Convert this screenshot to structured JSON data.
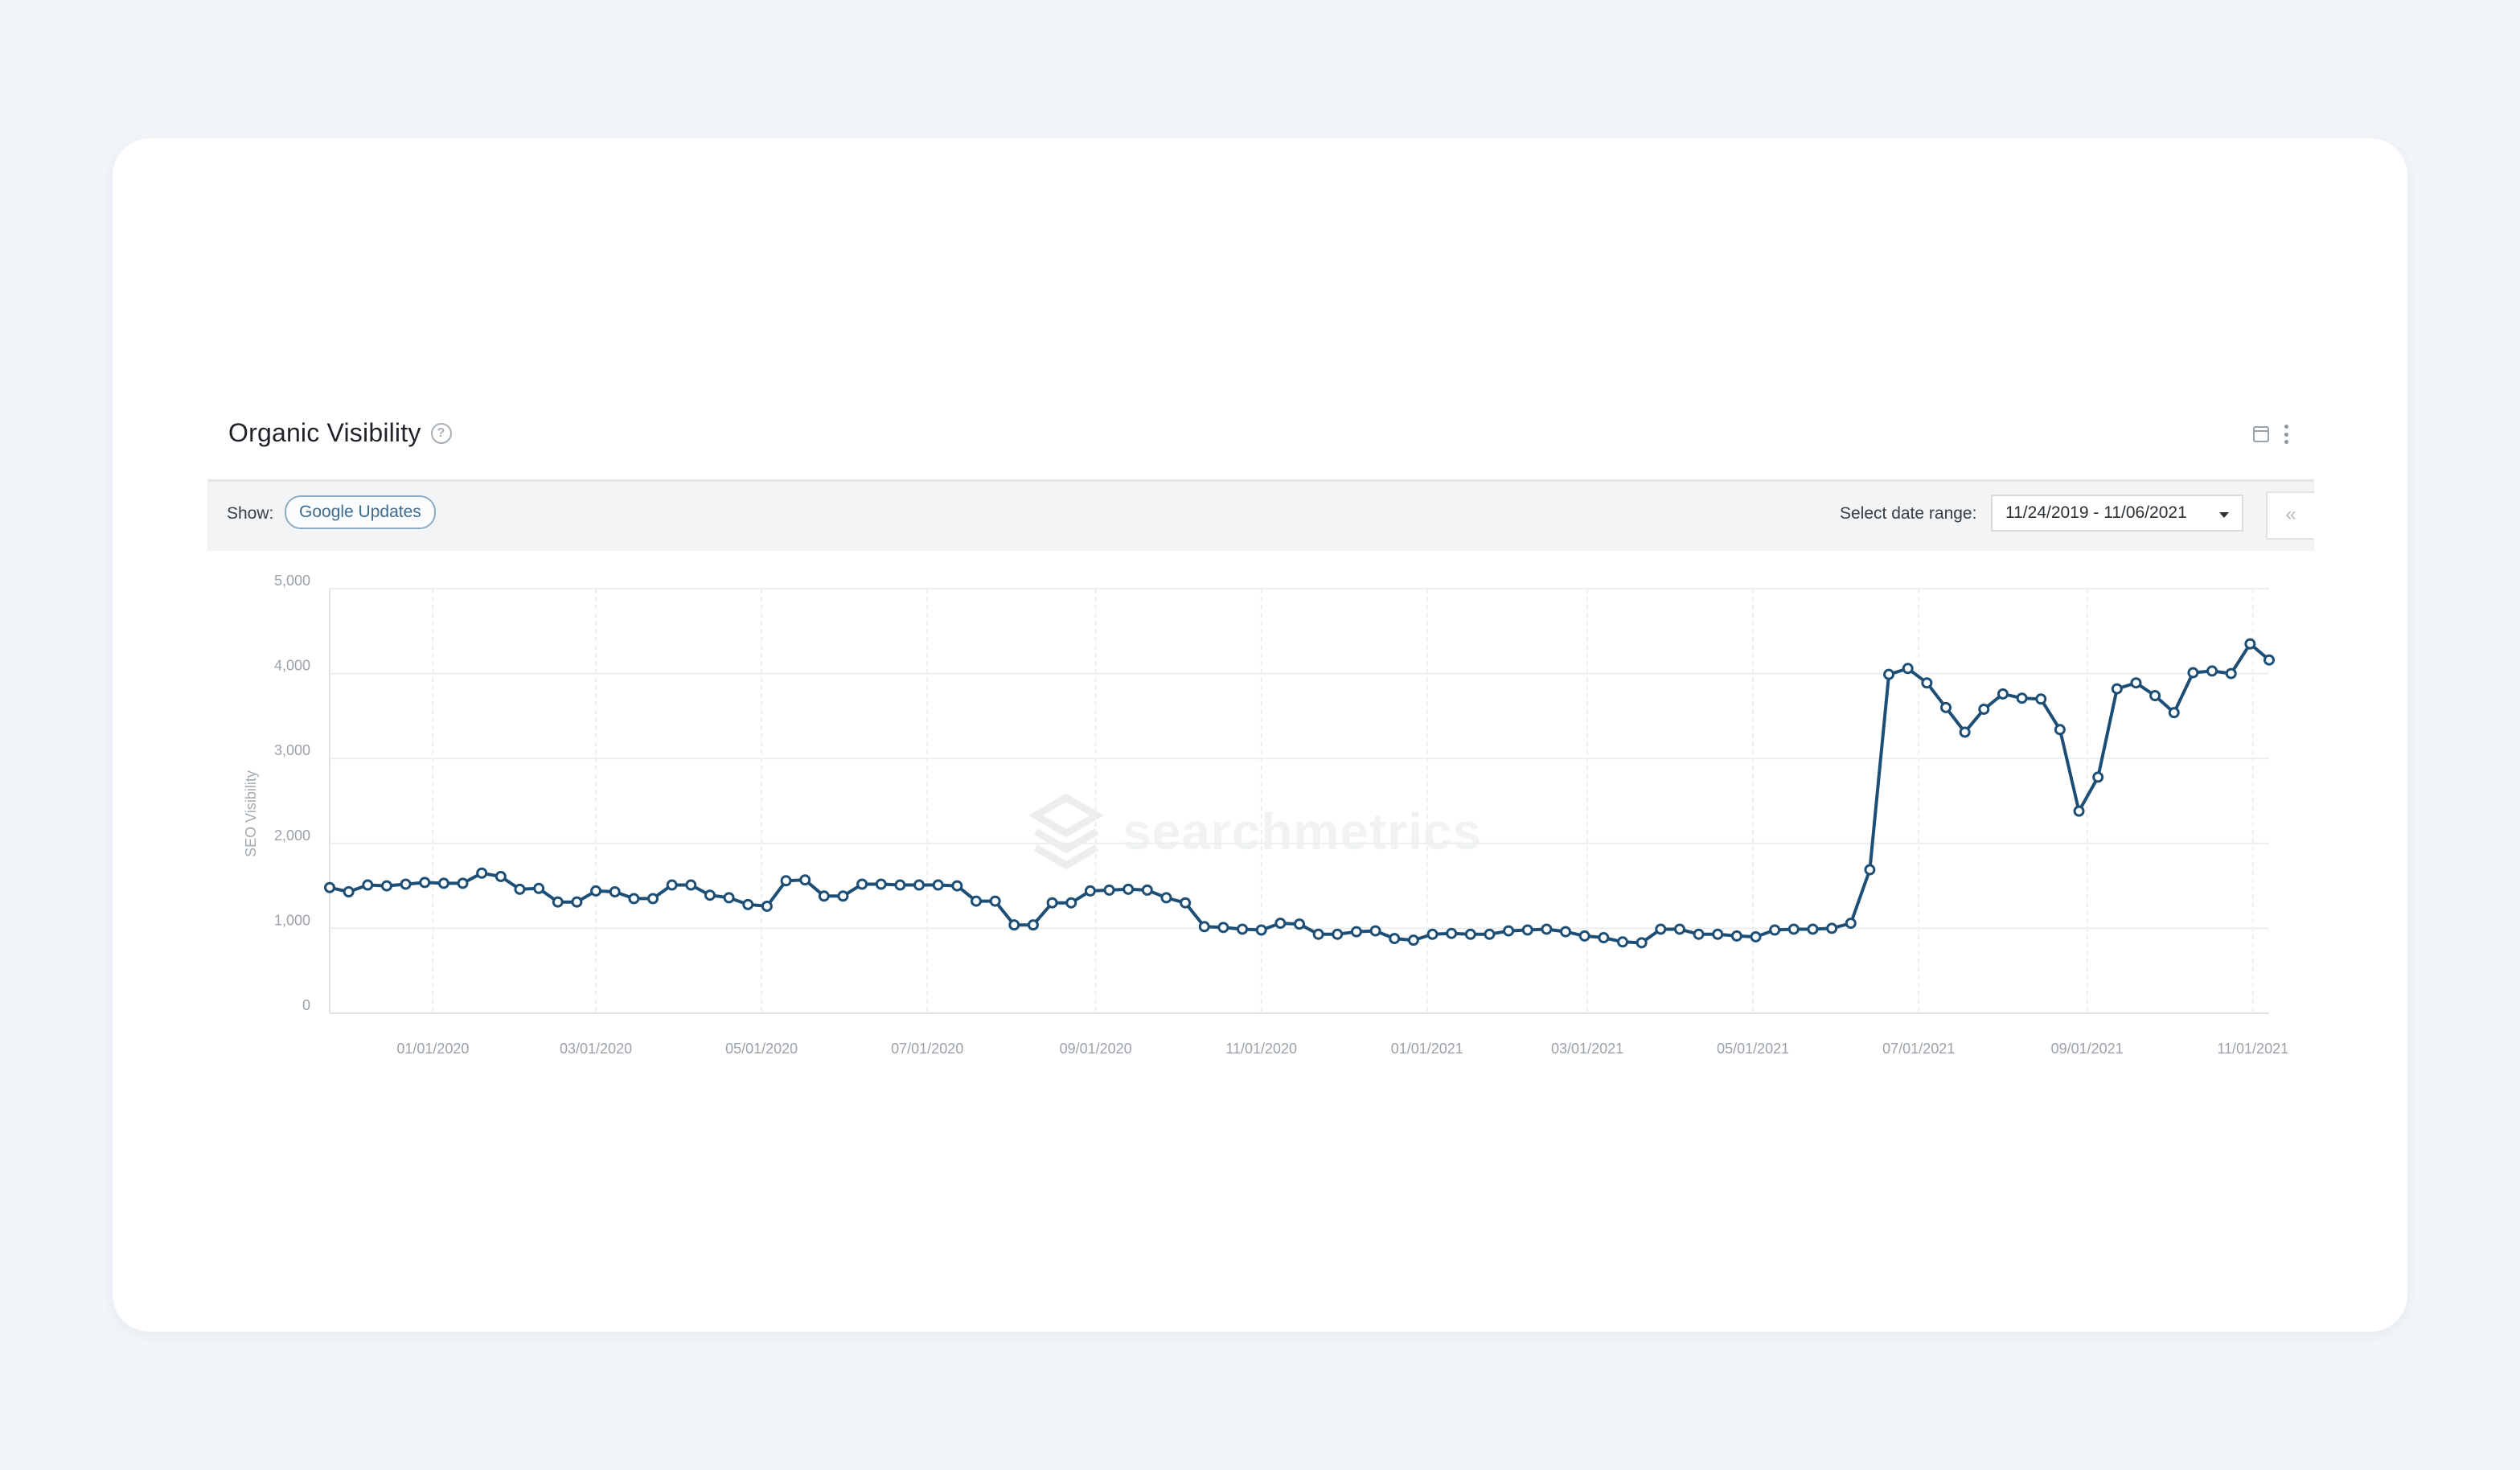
{
  "widget": {
    "title": "Organic Visibility",
    "help_icon": "question-circle-icon",
    "calendar_icon": "calendar-icon",
    "menu_icon": "kebab-menu-icon"
  },
  "toolbar": {
    "show_label": "Show:",
    "google_updates_label": "Google Updates",
    "date_range_label": "Select date range:",
    "date_range_value": "11/24/2019 - 11/06/2021",
    "collapse_label": "«"
  },
  "watermark": {
    "text": "searchmetrics"
  },
  "colors": {
    "line": "#1d4e75",
    "card": "#ffffff",
    "background": "#f2f6f9",
    "grid": "#eceff1"
  },
  "chart_data": {
    "type": "line",
    "title": "",
    "ylabel": "SEO Visibility",
    "ylim": [
      0,
      5000
    ],
    "yticks": [
      0,
      1000,
      2000,
      3000,
      4000,
      5000
    ],
    "ytick_labels": [
      "0",
      "1,000",
      "2,000",
      "3,000",
      "4,000",
      "5,000"
    ],
    "xlim": [
      "2019-11-24",
      "2021-11-07"
    ],
    "xtick_labels": [
      "01/01/2020",
      "03/01/2020",
      "05/01/2020",
      "07/01/2020",
      "09/01/2020",
      "11/01/2020",
      "01/01/2021",
      "03/01/2021",
      "05/01/2021",
      "07/01/2021",
      "09/01/2021",
      "11/01/2021"
    ],
    "xtick_dates": [
      "2020-01-01",
      "2020-03-01",
      "2020-05-01",
      "2020-07-01",
      "2020-09-01",
      "2020-11-01",
      "2021-01-01",
      "2021-03-01",
      "2021-05-01",
      "2021-07-01",
      "2021-09-01",
      "2021-11-01"
    ],
    "grid": true,
    "series": [
      {
        "x": [
          "2019-11-24",
          "2019-12-01",
          "2019-12-08",
          "2019-12-15",
          "2019-12-22",
          "2019-12-29",
          "2020-01-05",
          "2020-01-12",
          "2020-01-19",
          "2020-01-26",
          "2020-02-02",
          "2020-02-09",
          "2020-02-16",
          "2020-02-23",
          "2020-03-01",
          "2020-03-08",
          "2020-03-15",
          "2020-03-22",
          "2020-03-29",
          "2020-04-05",
          "2020-04-12",
          "2020-04-19",
          "2020-04-26",
          "2020-05-03",
          "2020-05-10",
          "2020-05-17",
          "2020-05-24",
          "2020-05-31",
          "2020-06-07",
          "2020-06-14",
          "2020-06-21",
          "2020-06-28",
          "2020-07-05",
          "2020-07-12",
          "2020-07-19",
          "2020-07-26",
          "2020-08-02",
          "2020-08-09",
          "2020-08-16",
          "2020-08-23",
          "2020-08-30",
          "2020-09-06",
          "2020-09-13",
          "2020-09-20",
          "2020-09-27",
          "2020-10-04",
          "2020-10-11",
          "2020-10-18",
          "2020-10-25",
          "2020-11-01",
          "2020-11-08",
          "2020-11-15",
          "2020-11-22",
          "2020-11-29",
          "2020-12-06",
          "2020-12-13",
          "2020-12-20",
          "2020-12-27",
          "2021-01-03",
          "2021-01-10",
          "2021-01-17",
          "2021-01-24",
          "2021-01-31",
          "2021-02-07",
          "2021-02-14",
          "2021-02-21",
          "2021-02-28",
          "2021-03-07",
          "2021-03-14",
          "2021-03-21",
          "2021-03-28",
          "2021-04-04",
          "2021-04-11",
          "2021-04-18",
          "2021-04-25",
          "2021-05-02",
          "2021-05-09",
          "2021-05-16",
          "2021-05-23",
          "2021-05-30",
          "2021-06-06",
          "2021-06-13",
          "2021-06-20",
          "2021-06-27",
          "2021-07-04",
          "2021-07-11",
          "2021-07-18",
          "2021-07-25",
          "2021-08-01",
          "2021-08-08",
          "2021-08-15",
          "2021-08-22",
          "2021-08-29",
          "2021-09-05",
          "2021-09-12",
          "2021-09-19",
          "2021-09-26",
          "2021-10-03",
          "2021-10-10",
          "2021-10-17",
          "2021-10-24",
          "2021-10-31",
          "2021-11-07"
        ],
        "values": [
          1480,
          1430,
          1510,
          1500,
          1520,
          1540,
          1530,
          1530,
          1650,
          1610,
          1460,
          1470,
          1310,
          1310,
          1440,
          1430,
          1350,
          1350,
          1510,
          1510,
          1390,
          1360,
          1280,
          1260,
          1560,
          1570,
          1380,
          1380,
          1520,
          1520,
          1510,
          1510,
          1510,
          1500,
          1320,
          1320,
          1040,
          1040,
          1300,
          1300,
          1440,
          1450,
          1460,
          1450,
          1360,
          1300,
          1020,
          1010,
          990,
          980,
          1060,
          1050,
          930,
          930,
          960,
          970,
          880,
          860,
          930,
          940,
          930,
          930,
          970,
          980,
          990,
          960,
          910,
          890,
          840,
          830,
          990,
          990,
          930,
          930,
          910,
          900,
          980,
          990,
          990,
          1000,
          1060,
          1690,
          3990,
          4060,
          3890,
          3600,
          3310,
          3580,
          3760,
          3710,
          3700,
          3340,
          2380,
          2780,
          3820,
          3890,
          3740,
          3540,
          4010,
          4030,
          4000,
          4350,
          4160
        ]
      }
    ]
  }
}
